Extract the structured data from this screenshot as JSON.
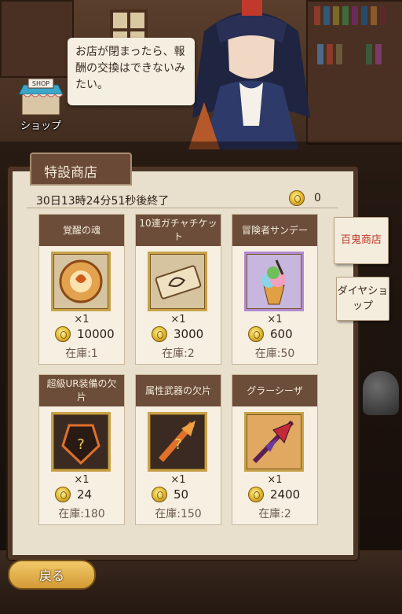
{
  "header": {
    "speech": "お店が閉まったら、報酬の交換はできないみたい。",
    "shop_label": "ショップ",
    "shop_sign": "SHOP"
  },
  "panel": {
    "title": "特設商店",
    "timer": "30日13時24分51秒後終了",
    "currency_count": "0",
    "icon": "coin-icon"
  },
  "items": [
    {
      "name": "覚醒の魂",
      "qty": "×1",
      "price": "10000",
      "stock": "在庫:1",
      "icon": "awakening-soul-icon"
    },
    {
      "name": "10連ガチャチケット",
      "qty": "×1",
      "price": "3000",
      "stock": "在庫:2",
      "icon": "gacha-ticket-icon"
    },
    {
      "name": "冒険者サンデー",
      "qty": "×1",
      "price": "600",
      "stock": "在庫:50",
      "icon": "sundae-icon"
    },
    {
      "name": "超級UR装備の欠片",
      "qty": "×1",
      "price": "24",
      "stock": "在庫:180",
      "icon": "ur-equipment-fragment-icon"
    },
    {
      "name": "属性武器の欠片",
      "qty": "×1",
      "price": "50",
      "stock": "在庫:150",
      "icon": "element-weapon-fragment-icon"
    },
    {
      "name": "グラーシーザ",
      "qty": "×1",
      "price": "2400",
      "stock": "在庫:2",
      "icon": "glaive-weapon-icon"
    }
  ],
  "side_tabs": [
    {
      "label": "百鬼商店",
      "active": true,
      "color": "#c0392b"
    },
    {
      "label": "ダイヤショップ",
      "active": false,
      "color": "#3a2a20"
    }
  ],
  "footer": {
    "back_label": "戻る"
  },
  "colors": {
    "card_header": "#6b4d3a",
    "panel": "#e9dfcd",
    "accent_gold": "#e9c23c"
  }
}
